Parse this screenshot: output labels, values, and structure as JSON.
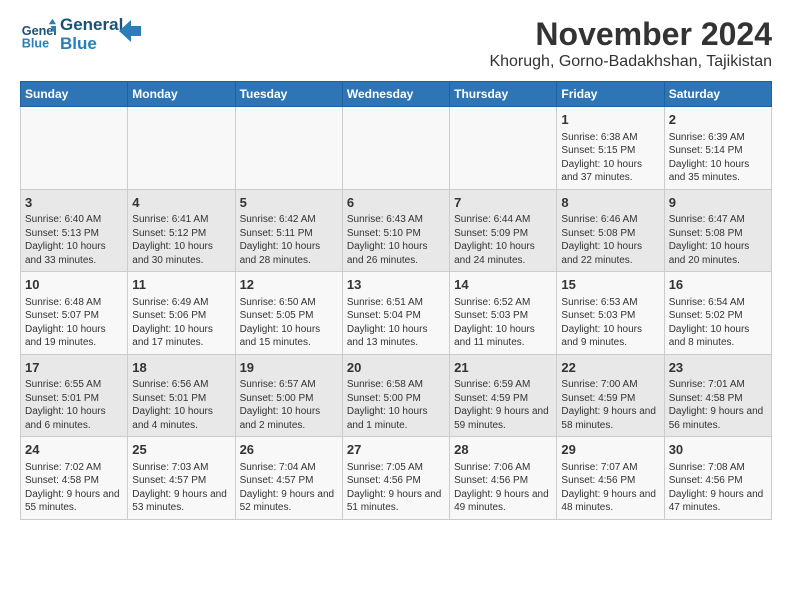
{
  "header": {
    "logo_line1": "General",
    "logo_line2": "Blue",
    "month": "November 2024",
    "location": "Khorugh, Gorno-Badakhshan, Tajikistan"
  },
  "days_of_week": [
    "Sunday",
    "Monday",
    "Tuesday",
    "Wednesday",
    "Thursday",
    "Friday",
    "Saturday"
  ],
  "weeks": [
    [
      {
        "day": "",
        "content": ""
      },
      {
        "day": "",
        "content": ""
      },
      {
        "day": "",
        "content": ""
      },
      {
        "day": "",
        "content": ""
      },
      {
        "day": "",
        "content": ""
      },
      {
        "day": "1",
        "content": "Sunrise: 6:38 AM\nSunset: 5:15 PM\nDaylight: 10 hours and 37 minutes."
      },
      {
        "day": "2",
        "content": "Sunrise: 6:39 AM\nSunset: 5:14 PM\nDaylight: 10 hours and 35 minutes."
      }
    ],
    [
      {
        "day": "3",
        "content": "Sunrise: 6:40 AM\nSunset: 5:13 PM\nDaylight: 10 hours and 33 minutes."
      },
      {
        "day": "4",
        "content": "Sunrise: 6:41 AM\nSunset: 5:12 PM\nDaylight: 10 hours and 30 minutes."
      },
      {
        "day": "5",
        "content": "Sunrise: 6:42 AM\nSunset: 5:11 PM\nDaylight: 10 hours and 28 minutes."
      },
      {
        "day": "6",
        "content": "Sunrise: 6:43 AM\nSunset: 5:10 PM\nDaylight: 10 hours and 26 minutes."
      },
      {
        "day": "7",
        "content": "Sunrise: 6:44 AM\nSunset: 5:09 PM\nDaylight: 10 hours and 24 minutes."
      },
      {
        "day": "8",
        "content": "Sunrise: 6:46 AM\nSunset: 5:08 PM\nDaylight: 10 hours and 22 minutes."
      },
      {
        "day": "9",
        "content": "Sunrise: 6:47 AM\nSunset: 5:08 PM\nDaylight: 10 hours and 20 minutes."
      }
    ],
    [
      {
        "day": "10",
        "content": "Sunrise: 6:48 AM\nSunset: 5:07 PM\nDaylight: 10 hours and 19 minutes."
      },
      {
        "day": "11",
        "content": "Sunrise: 6:49 AM\nSunset: 5:06 PM\nDaylight: 10 hours and 17 minutes."
      },
      {
        "day": "12",
        "content": "Sunrise: 6:50 AM\nSunset: 5:05 PM\nDaylight: 10 hours and 15 minutes."
      },
      {
        "day": "13",
        "content": "Sunrise: 6:51 AM\nSunset: 5:04 PM\nDaylight: 10 hours and 13 minutes."
      },
      {
        "day": "14",
        "content": "Sunrise: 6:52 AM\nSunset: 5:03 PM\nDaylight: 10 hours and 11 minutes."
      },
      {
        "day": "15",
        "content": "Sunrise: 6:53 AM\nSunset: 5:03 PM\nDaylight: 10 hours and 9 minutes."
      },
      {
        "day": "16",
        "content": "Sunrise: 6:54 AM\nSunset: 5:02 PM\nDaylight: 10 hours and 8 minutes."
      }
    ],
    [
      {
        "day": "17",
        "content": "Sunrise: 6:55 AM\nSunset: 5:01 PM\nDaylight: 10 hours and 6 minutes."
      },
      {
        "day": "18",
        "content": "Sunrise: 6:56 AM\nSunset: 5:01 PM\nDaylight: 10 hours and 4 minutes."
      },
      {
        "day": "19",
        "content": "Sunrise: 6:57 AM\nSunset: 5:00 PM\nDaylight: 10 hours and 2 minutes."
      },
      {
        "day": "20",
        "content": "Sunrise: 6:58 AM\nSunset: 5:00 PM\nDaylight: 10 hours and 1 minute."
      },
      {
        "day": "21",
        "content": "Sunrise: 6:59 AM\nSunset: 4:59 PM\nDaylight: 9 hours and 59 minutes."
      },
      {
        "day": "22",
        "content": "Sunrise: 7:00 AM\nSunset: 4:59 PM\nDaylight: 9 hours and 58 minutes."
      },
      {
        "day": "23",
        "content": "Sunrise: 7:01 AM\nSunset: 4:58 PM\nDaylight: 9 hours and 56 minutes."
      }
    ],
    [
      {
        "day": "24",
        "content": "Sunrise: 7:02 AM\nSunset: 4:58 PM\nDaylight: 9 hours and 55 minutes."
      },
      {
        "day": "25",
        "content": "Sunrise: 7:03 AM\nSunset: 4:57 PM\nDaylight: 9 hours and 53 minutes."
      },
      {
        "day": "26",
        "content": "Sunrise: 7:04 AM\nSunset: 4:57 PM\nDaylight: 9 hours and 52 minutes."
      },
      {
        "day": "27",
        "content": "Sunrise: 7:05 AM\nSunset: 4:56 PM\nDaylight: 9 hours and 51 minutes."
      },
      {
        "day": "28",
        "content": "Sunrise: 7:06 AM\nSunset: 4:56 PM\nDaylight: 9 hours and 49 minutes."
      },
      {
        "day": "29",
        "content": "Sunrise: 7:07 AM\nSunset: 4:56 PM\nDaylight: 9 hours and 48 minutes."
      },
      {
        "day": "30",
        "content": "Sunrise: 7:08 AM\nSunset: 4:56 PM\nDaylight: 9 hours and 47 minutes."
      }
    ]
  ]
}
